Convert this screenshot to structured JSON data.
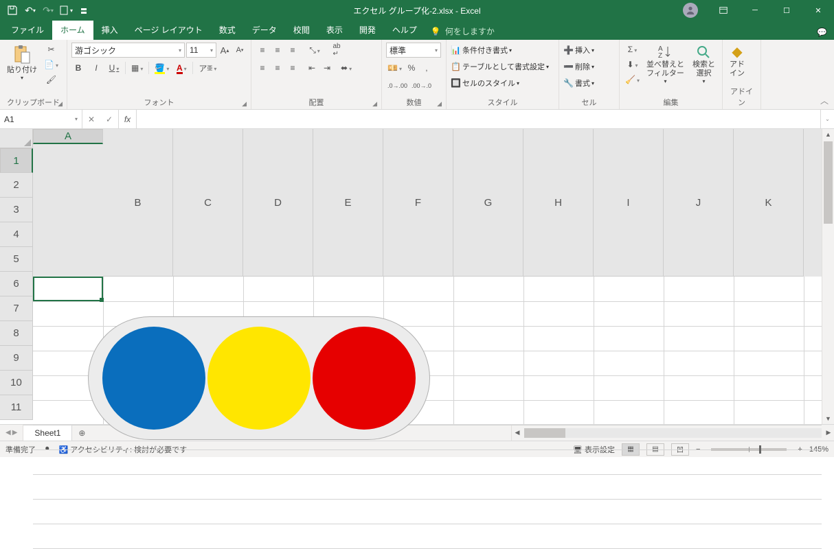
{
  "titlebar": {
    "title": "エクセル グループ化-2.xlsx - Excel"
  },
  "tabs": {
    "file": "ファイル",
    "home": "ホーム",
    "insert": "挿入",
    "pagelayout": "ページ レイアウト",
    "formulas": "数式",
    "data": "データ",
    "review": "校閲",
    "view": "表示",
    "developer": "開発",
    "help": "ヘルプ",
    "tellme": "何をしますか"
  },
  "ribbon": {
    "clipboard": {
      "label": "クリップボード",
      "paste": "貼り付け"
    },
    "font": {
      "label": "フォント",
      "name": "游ゴシック",
      "size": "11",
      "bold": "B",
      "italic": "I",
      "underline": "U"
    },
    "alignment": {
      "label": "配置",
      "wrap": "ab"
    },
    "number": {
      "label": "数値",
      "format": "標準"
    },
    "styles": {
      "label": "スタイル",
      "cond": "条件付き書式",
      "table": "テーブルとして書式設定",
      "cell": "セルのスタイル"
    },
    "cells": {
      "label": "セル",
      "insert": "挿入",
      "delete": "削除",
      "format": "書式"
    },
    "editing": {
      "label": "編集",
      "sort": "並べ替えと\nフィルター",
      "find": "検索と\n選択"
    },
    "addins": {
      "label": "アドイン",
      "addin": "アド\nイン"
    }
  },
  "namebox": "A1",
  "columns": [
    "A",
    "B",
    "C",
    "D",
    "E",
    "F",
    "G",
    "H",
    "I",
    "J",
    "K"
  ],
  "rows": [
    "1",
    "2",
    "3",
    "4",
    "5",
    "6",
    "7",
    "8",
    "9",
    "10",
    "11"
  ],
  "sheet": {
    "name": "Sheet1"
  },
  "status": {
    "ready": "準備完了",
    "accessibility": "アクセシビリティ: 検討が必要です",
    "display": "表示設定",
    "zoom": "145%"
  },
  "shapes": {
    "colors": [
      "#0a6ebd",
      "#ffe600",
      "#e60000"
    ],
    "container_fill": "#ececec"
  }
}
